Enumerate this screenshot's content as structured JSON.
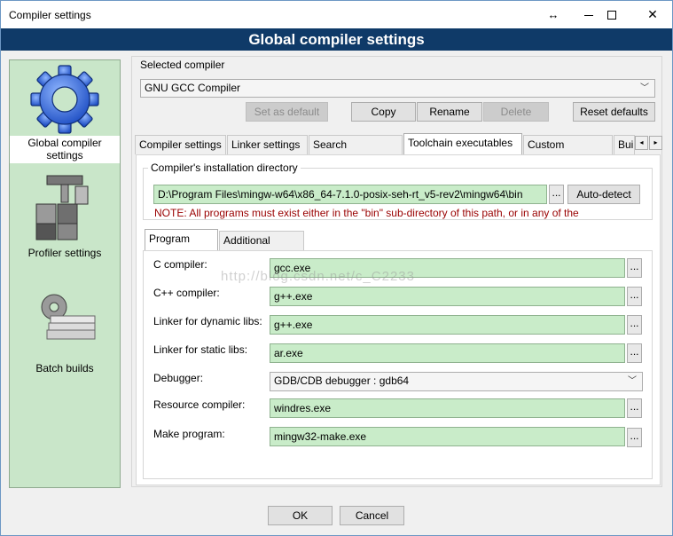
{
  "window": {
    "title": "Compiler settings",
    "resize_glyph": "↔",
    "minimize_glyph": "",
    "maximize_glyph": "",
    "close_glyph": "✕"
  },
  "header": {
    "title": "Global compiler settings"
  },
  "sidebar": {
    "items": [
      {
        "label": "Global compiler settings",
        "icon": "gear-icon",
        "selected": true
      },
      {
        "label": "Profiler settings",
        "icon": "profiler-icon",
        "selected": false
      },
      {
        "label": "Batch builds",
        "icon": "batch-builds-icon",
        "selected": false
      }
    ]
  },
  "selected_compiler": {
    "group_label": "Selected compiler",
    "value": "GNU GCC Compiler",
    "buttons": {
      "set_default": "Set as default",
      "copy": "Copy",
      "rename": "Rename",
      "delete": "Delete",
      "reset_defaults": "Reset defaults"
    }
  },
  "tabs": [
    {
      "label": "Compiler settings",
      "active": false
    },
    {
      "label": "Linker settings",
      "active": false
    },
    {
      "label": "Search directories",
      "active": false
    },
    {
      "label": "Toolchain executables",
      "active": true
    },
    {
      "label": "Custom variables",
      "active": false
    },
    {
      "label": "Bui",
      "active": false
    }
  ],
  "tab_scroll": {
    "left": "◂",
    "right": "▸"
  },
  "toolchain": {
    "install_dir_label": "Compiler's installation directory",
    "install_dir_value": "D:\\Program Files\\mingw-w64\\x86_64-7.1.0-posix-seh-rt_v5-rev2\\mingw64\\bin",
    "browse_label": "...",
    "auto_detect": "Auto-detect",
    "note": "NOTE: All programs must exist either in the \"bin\" sub-directory of this path, or in any of the"
  },
  "subtabs": [
    {
      "label": "Program Files",
      "active": true
    },
    {
      "label": "Additional Paths",
      "active": false
    }
  ],
  "programs": {
    "c_compiler": {
      "label": "C compiler:",
      "value": "gcc.exe"
    },
    "cpp_compiler": {
      "label": "C++ compiler:",
      "value": "g++.exe"
    },
    "linker_dynamic": {
      "label": "Linker for dynamic libs:",
      "value": "g++.exe"
    },
    "linker_static": {
      "label": "Linker for static libs:",
      "value": "ar.exe"
    },
    "debugger": {
      "label": "Debugger:",
      "value": "GDB/CDB debugger : gdb64"
    },
    "resource_compiler": {
      "label": "Resource compiler:",
      "value": "windres.exe"
    },
    "make_program": {
      "label": "Make program:",
      "value": "mingw32-make.exe"
    },
    "browse_label": "..."
  },
  "watermark": "http://blog.csdn.net/c_C2233",
  "footer": {
    "ok": "OK",
    "cancel": "Cancel"
  },
  "colors": {
    "header_band": "#0f3a68",
    "sidebar_bg": "#c9e6c9",
    "input_green": "#c9ecc9",
    "note_red": "#990000"
  }
}
